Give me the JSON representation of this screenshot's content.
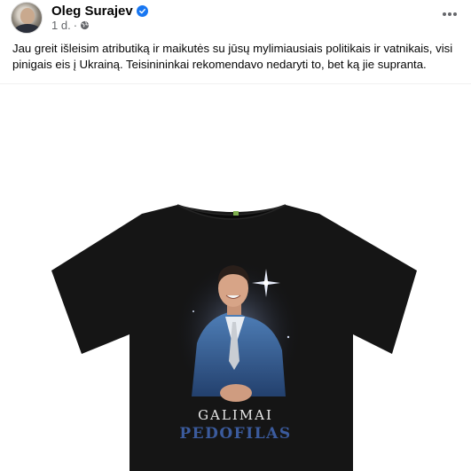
{
  "post": {
    "author": "Oleg Surajev",
    "time": "1 d.",
    "text": "Jau greit išleisim atributiką ir maikutės su jūsų mylimiausiais politikais ir vatnikais, visi pinigais eis į Ukrainą. Teisinininkai rekomendavo nedaryti to, bet ką jie supranta."
  },
  "image": {
    "caption_line1": "GALIMAI",
    "caption_line2": "PEDOFILAS"
  },
  "icons": {
    "verified": "verified-badge-icon",
    "privacy": "globe-icon",
    "menu": "more-options-icon"
  },
  "colors": {
    "verified": "#1877f2",
    "meta_text": "#65676b",
    "shirt": "#151515",
    "caption_blue": "#3b5b9d"
  }
}
